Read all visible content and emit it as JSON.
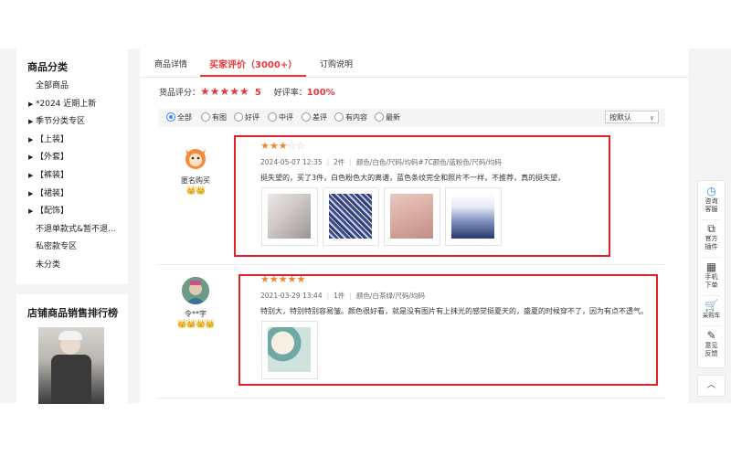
{
  "sidebar": {
    "category_title": "商品分类",
    "categories": [
      {
        "label": "全部商品",
        "arrow": false
      },
      {
        "label": "*2024 近期上新",
        "arrow": true
      },
      {
        "label": "季节分类专区",
        "arrow": true
      },
      {
        "label": "【上装】",
        "arrow": true
      },
      {
        "label": "【外套】",
        "arrow": true
      },
      {
        "label": "【裤装】",
        "arrow": true
      },
      {
        "label": "【裙装】",
        "arrow": true
      },
      {
        "label": "【配饰】",
        "arrow": true
      },
      {
        "label": "不退单款式&暂不退...",
        "arrow": false
      },
      {
        "label": "私密款专区",
        "arrow": false
      },
      {
        "label": "未分类",
        "arrow": false
      }
    ],
    "rank_title": "店铺商品销售排行榜"
  },
  "tabs": [
    {
      "label": "商品详情"
    },
    {
      "label": "买家评价（3000+）"
    },
    {
      "label": "订购说明"
    }
  ],
  "score": {
    "label": "货品评分：",
    "stars": "★★★★★",
    "value": "5",
    "rate_label": "好评率：",
    "rate": "100%"
  },
  "filters": {
    "options": [
      "全部",
      "有图",
      "好评",
      "中评",
      "差评",
      "有内容",
      "最新"
    ],
    "selected": "全部",
    "sort": "按默认"
  },
  "reviews": [
    {
      "user": "匿名购买",
      "level": "👑👑",
      "rating": 3,
      "date": "2024-05-07 12:35",
      "qty": "2件",
      "spec": "颜色/白色/尺码/均码#7C颜色/蓝粉色/尺码/均码",
      "text": "挺失望的，买了3件，白色粉色大的离谱，蓝色条纹完全和照片不一样，不推荐，真的挺失望，",
      "images": [
        "s1",
        "s2",
        "s3",
        "s4"
      ]
    },
    {
      "user": "令**宇",
      "level": "👑👑👑👑",
      "rating": 5,
      "date": "2021-03-29 13:44",
      "qty": "1件",
      "spec": "颜色/白茶绿/尺码/均码",
      "text": "特别大，特别特别容易皱。颜色很好看，就是没有图片有上抹光的感觉挺夏天的，盛夏的时候穿不了，因为有点不透气。",
      "images": [
        "s5"
      ]
    }
  ],
  "float_bar": [
    {
      "icon": "◷",
      "label": "咨询客服"
    },
    {
      "icon": "⧉",
      "label": "官方插件"
    },
    {
      "icon": "▦",
      "label": "手机下单"
    },
    {
      "icon": "🛒",
      "label": "采购车"
    },
    {
      "icon": "✎",
      "label": "意见反馈"
    }
  ],
  "colors": {
    "accent": "#e4393c",
    "star": "#f0852d",
    "highlight_box": "#e0202a",
    "radio_selected": "#3a86ff"
  }
}
